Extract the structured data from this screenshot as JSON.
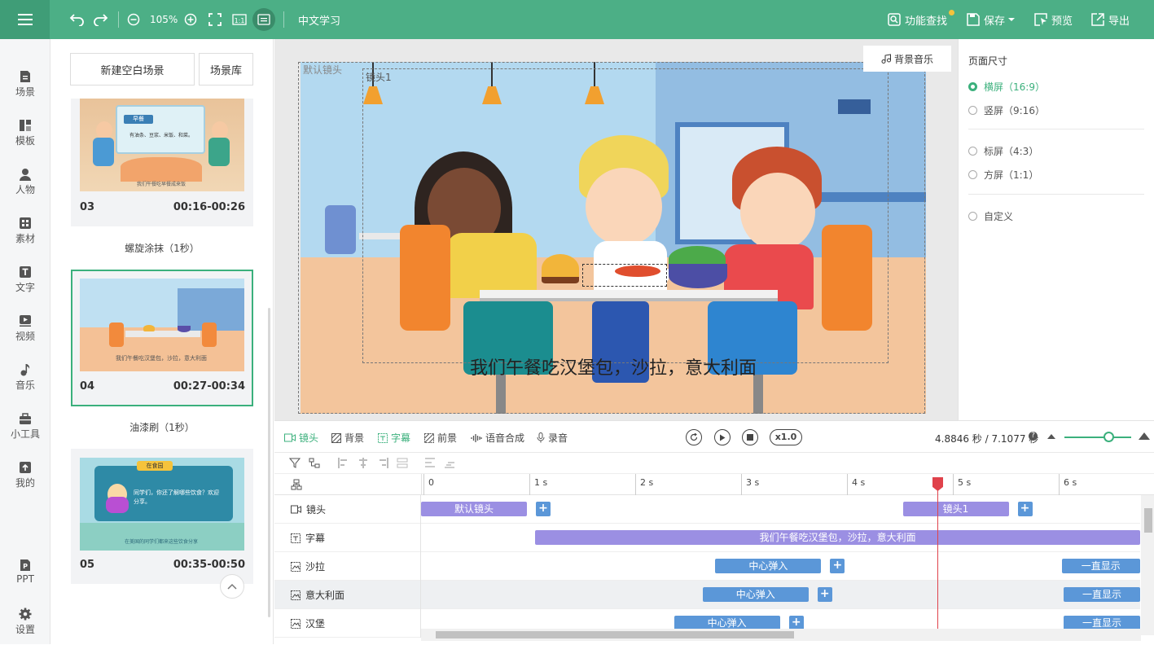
{
  "topbar": {
    "zoom": "105%",
    "project_title": "中文学习",
    "find_label": "功能查找",
    "save_label": "保存",
    "preview_label": "预览",
    "export_label": "导出"
  },
  "leftnav": [
    {
      "label": "场景",
      "icon": "scene-icon"
    },
    {
      "label": "模板",
      "icon": "template-icon"
    },
    {
      "label": "人物",
      "icon": "person-icon"
    },
    {
      "label": "素材",
      "icon": "material-icon"
    },
    {
      "label": "文字",
      "icon": "text-icon"
    },
    {
      "label": "视频",
      "icon": "video-icon"
    },
    {
      "label": "音乐",
      "icon": "music-icon"
    },
    {
      "label": "小工具",
      "icon": "toolbox-icon"
    },
    {
      "label": "我的",
      "icon": "upload-icon"
    },
    {
      "label": "PPT",
      "icon": "ppt-icon"
    },
    {
      "label": "设置",
      "icon": "gear-icon"
    }
  ],
  "scenepanel": {
    "new_blank": "新建空白场景",
    "library": "场景库",
    "scenes": [
      {
        "num": "03",
        "time": "00:16-00:26",
        "thumb_title": "早餐",
        "thumb_text": "有油条、豆浆、米饭、和菜。",
        "thumb_caption": "我们午餐吃早餐成来饭"
      },
      {
        "num": "04",
        "time": "00:27-00:34",
        "thumb_caption": "我们午餐吃汉堡包，沙拉，意大利面"
      },
      {
        "num": "05",
        "time": "00:35-00:50",
        "thumb_title": "在食园",
        "thumb_text": "同学们，你还了解哪些饮食？欢迎分享。",
        "thumb_caption": "在美国的同学们都来这些饮食分享"
      }
    ],
    "transitions": [
      "螺旋涂抹（1秒）",
      "油漆刷（1秒）"
    ]
  },
  "canvas": {
    "bg_music": "背景音乐",
    "default_cam_label": "默认镜头",
    "cam1_label": "镜头1",
    "subtitle": "我们午餐吃汉堡包，沙拉，意大利面"
  },
  "rightpanel": {
    "title": "页面尺寸",
    "options": [
      {
        "label": "横屏（16:9）",
        "selected": true
      },
      {
        "label": "竖屏（9:16）",
        "selected": false
      },
      {
        "label": "标屏（4:3）",
        "selected": false
      },
      {
        "label": "方屏（1:1）",
        "selected": false
      },
      {
        "label": "自定义",
        "selected": false
      }
    ]
  },
  "timeline": {
    "tabs": [
      "镜头",
      "背景",
      "字幕",
      "前景",
      "语音合成",
      "录音"
    ],
    "active_tab": "字幕",
    "speed": "x1.0",
    "time_readout": "4.8846 秒 / 7.1077 秒",
    "ticks": [
      "0",
      "1 s",
      "2 s",
      "3 s",
      "4 s",
      "5 s",
      "6 s"
    ],
    "playhead_seconds": 4.8846,
    "rows": [
      {
        "label": "镜头",
        "clips": [
          {
            "text": "默认镜头",
            "start": 0,
            "end": 1
          },
          {
            "text": "镜头1",
            "start": 4.55,
            "end": 5.55
          }
        ]
      },
      {
        "label": "字幕",
        "clips": [
          {
            "text": "我们午餐吃汉堡包，沙拉，意大利面",
            "start": 1.08,
            "end": 6.8
          }
        ]
      },
      {
        "label": "沙拉",
        "clips": [
          {
            "text": "中心弹入",
            "start": 2.78,
            "end": 3.78
          },
          {
            "text": "一直显示",
            "start": 6.05,
            "end": 6.8
          }
        ]
      },
      {
        "label": "意大利面",
        "clips": [
          {
            "text": "中心弹入",
            "start": 2.66,
            "end": 3.66
          },
          {
            "text": "一直显示",
            "start": 6.07,
            "end": 6.8
          }
        ]
      },
      {
        "label": "汉堡",
        "clips": [
          {
            "text": "中心弹入",
            "start": 2.39,
            "end": 3.39
          },
          {
            "text": "一直显示",
            "start": 6.07,
            "end": 6.8
          }
        ]
      }
    ]
  },
  "colors": {
    "brand": "#4caf86",
    "clip_purple": "#9b8fe3",
    "clip_blue": "#5b97d8",
    "playhead": "#e0424b"
  }
}
